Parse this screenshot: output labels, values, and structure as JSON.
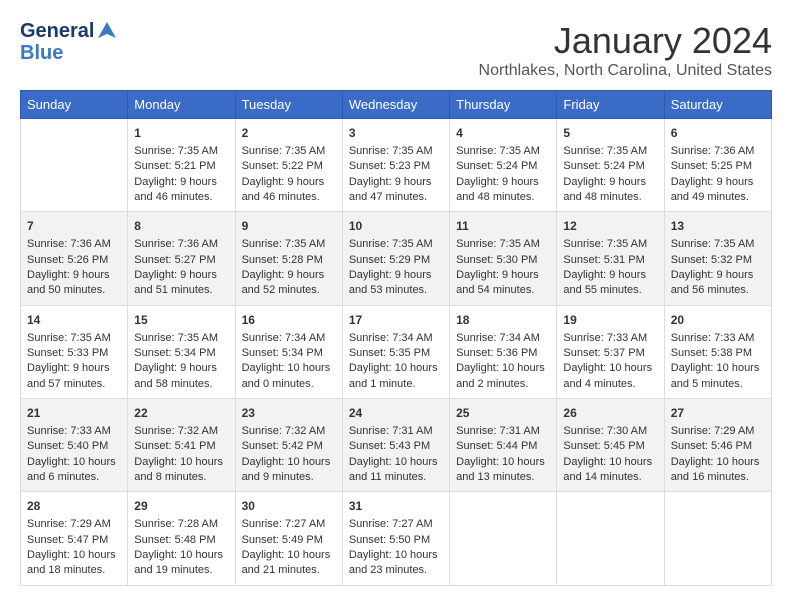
{
  "header": {
    "logo_line1": "General",
    "logo_line2": "Blue",
    "title": "January 2024",
    "subtitle": "Northlakes, North Carolina, United States"
  },
  "days_of_week": [
    "Sunday",
    "Monday",
    "Tuesday",
    "Wednesday",
    "Thursday",
    "Friday",
    "Saturday"
  ],
  "weeks": [
    [
      {
        "day": "",
        "sunrise": "",
        "sunset": "",
        "daylight": ""
      },
      {
        "day": "1",
        "sunrise": "Sunrise: 7:35 AM",
        "sunset": "Sunset: 5:21 PM",
        "daylight": "Daylight: 9 hours and 46 minutes."
      },
      {
        "day": "2",
        "sunrise": "Sunrise: 7:35 AM",
        "sunset": "Sunset: 5:22 PM",
        "daylight": "Daylight: 9 hours and 46 minutes."
      },
      {
        "day": "3",
        "sunrise": "Sunrise: 7:35 AM",
        "sunset": "Sunset: 5:23 PM",
        "daylight": "Daylight: 9 hours and 47 minutes."
      },
      {
        "day": "4",
        "sunrise": "Sunrise: 7:35 AM",
        "sunset": "Sunset: 5:24 PM",
        "daylight": "Daylight: 9 hours and 48 minutes."
      },
      {
        "day": "5",
        "sunrise": "Sunrise: 7:35 AM",
        "sunset": "Sunset: 5:24 PM",
        "daylight": "Daylight: 9 hours and 48 minutes."
      },
      {
        "day": "6",
        "sunrise": "Sunrise: 7:36 AM",
        "sunset": "Sunset: 5:25 PM",
        "daylight": "Daylight: 9 hours and 49 minutes."
      }
    ],
    [
      {
        "day": "7",
        "sunrise": "Sunrise: 7:36 AM",
        "sunset": "Sunset: 5:26 PM",
        "daylight": "Daylight: 9 hours and 50 minutes."
      },
      {
        "day": "8",
        "sunrise": "Sunrise: 7:36 AM",
        "sunset": "Sunset: 5:27 PM",
        "daylight": "Daylight: 9 hours and 51 minutes."
      },
      {
        "day": "9",
        "sunrise": "Sunrise: 7:35 AM",
        "sunset": "Sunset: 5:28 PM",
        "daylight": "Daylight: 9 hours and 52 minutes."
      },
      {
        "day": "10",
        "sunrise": "Sunrise: 7:35 AM",
        "sunset": "Sunset: 5:29 PM",
        "daylight": "Daylight: 9 hours and 53 minutes."
      },
      {
        "day": "11",
        "sunrise": "Sunrise: 7:35 AM",
        "sunset": "Sunset: 5:30 PM",
        "daylight": "Daylight: 9 hours and 54 minutes."
      },
      {
        "day": "12",
        "sunrise": "Sunrise: 7:35 AM",
        "sunset": "Sunset: 5:31 PM",
        "daylight": "Daylight: 9 hours and 55 minutes."
      },
      {
        "day": "13",
        "sunrise": "Sunrise: 7:35 AM",
        "sunset": "Sunset: 5:32 PM",
        "daylight": "Daylight: 9 hours and 56 minutes."
      }
    ],
    [
      {
        "day": "14",
        "sunrise": "Sunrise: 7:35 AM",
        "sunset": "Sunset: 5:33 PM",
        "daylight": "Daylight: 9 hours and 57 minutes."
      },
      {
        "day": "15",
        "sunrise": "Sunrise: 7:35 AM",
        "sunset": "Sunset: 5:34 PM",
        "daylight": "Daylight: 9 hours and 58 minutes."
      },
      {
        "day": "16",
        "sunrise": "Sunrise: 7:34 AM",
        "sunset": "Sunset: 5:34 PM",
        "daylight": "Daylight: 10 hours and 0 minutes."
      },
      {
        "day": "17",
        "sunrise": "Sunrise: 7:34 AM",
        "sunset": "Sunset: 5:35 PM",
        "daylight": "Daylight: 10 hours and 1 minute."
      },
      {
        "day": "18",
        "sunrise": "Sunrise: 7:34 AM",
        "sunset": "Sunset: 5:36 PM",
        "daylight": "Daylight: 10 hours and 2 minutes."
      },
      {
        "day": "19",
        "sunrise": "Sunrise: 7:33 AM",
        "sunset": "Sunset: 5:37 PM",
        "daylight": "Daylight: 10 hours and 4 minutes."
      },
      {
        "day": "20",
        "sunrise": "Sunrise: 7:33 AM",
        "sunset": "Sunset: 5:38 PM",
        "daylight": "Daylight: 10 hours and 5 minutes."
      }
    ],
    [
      {
        "day": "21",
        "sunrise": "Sunrise: 7:33 AM",
        "sunset": "Sunset: 5:40 PM",
        "daylight": "Daylight: 10 hours and 6 minutes."
      },
      {
        "day": "22",
        "sunrise": "Sunrise: 7:32 AM",
        "sunset": "Sunset: 5:41 PM",
        "daylight": "Daylight: 10 hours and 8 minutes."
      },
      {
        "day": "23",
        "sunrise": "Sunrise: 7:32 AM",
        "sunset": "Sunset: 5:42 PM",
        "daylight": "Daylight: 10 hours and 9 minutes."
      },
      {
        "day": "24",
        "sunrise": "Sunrise: 7:31 AM",
        "sunset": "Sunset: 5:43 PM",
        "daylight": "Daylight: 10 hours and 11 minutes."
      },
      {
        "day": "25",
        "sunrise": "Sunrise: 7:31 AM",
        "sunset": "Sunset: 5:44 PM",
        "daylight": "Daylight: 10 hours and 13 minutes."
      },
      {
        "day": "26",
        "sunrise": "Sunrise: 7:30 AM",
        "sunset": "Sunset: 5:45 PM",
        "daylight": "Daylight: 10 hours and 14 minutes."
      },
      {
        "day": "27",
        "sunrise": "Sunrise: 7:29 AM",
        "sunset": "Sunset: 5:46 PM",
        "daylight": "Daylight: 10 hours and 16 minutes."
      }
    ],
    [
      {
        "day": "28",
        "sunrise": "Sunrise: 7:29 AM",
        "sunset": "Sunset: 5:47 PM",
        "daylight": "Daylight: 10 hours and 18 minutes."
      },
      {
        "day": "29",
        "sunrise": "Sunrise: 7:28 AM",
        "sunset": "Sunset: 5:48 PM",
        "daylight": "Daylight: 10 hours and 19 minutes."
      },
      {
        "day": "30",
        "sunrise": "Sunrise: 7:27 AM",
        "sunset": "Sunset: 5:49 PM",
        "daylight": "Daylight: 10 hours and 21 minutes."
      },
      {
        "day": "31",
        "sunrise": "Sunrise: 7:27 AM",
        "sunset": "Sunset: 5:50 PM",
        "daylight": "Daylight: 10 hours and 23 minutes."
      },
      {
        "day": "",
        "sunrise": "",
        "sunset": "",
        "daylight": ""
      },
      {
        "day": "",
        "sunrise": "",
        "sunset": "",
        "daylight": ""
      },
      {
        "day": "",
        "sunrise": "",
        "sunset": "",
        "daylight": ""
      }
    ]
  ]
}
